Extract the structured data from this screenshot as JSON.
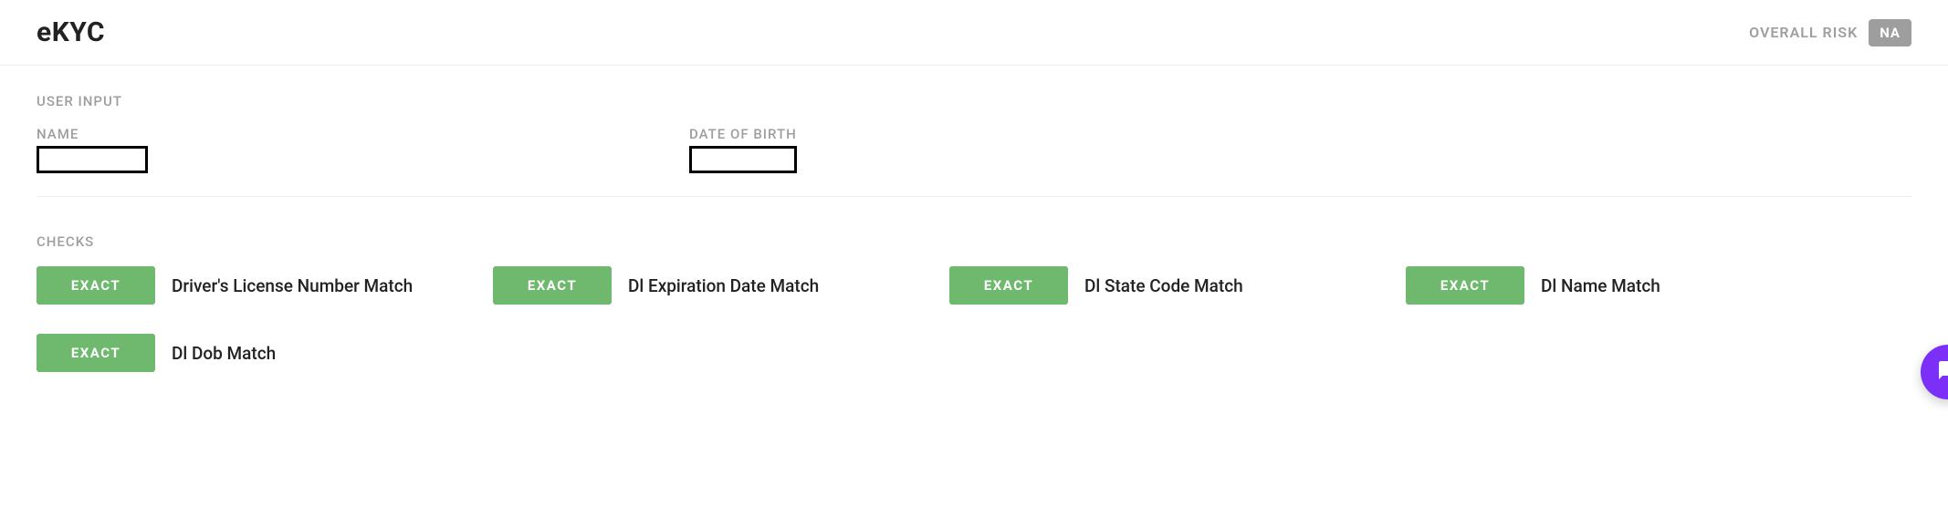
{
  "header": {
    "title": "eKYC",
    "risk_label": "OVERALL RISK",
    "risk_value": "NA"
  },
  "user_input": {
    "section_title": "USER INPUT",
    "fields": [
      {
        "label": "NAME",
        "value": ""
      },
      {
        "label": "DATE OF BIRTH",
        "value": ""
      }
    ]
  },
  "checks": {
    "section_title": "CHECKS",
    "items": [
      {
        "status": "EXACT",
        "label": "Driver's License Number Match"
      },
      {
        "status": "EXACT",
        "label": "Dl Expiration Date Match"
      },
      {
        "status": "EXACT",
        "label": "Dl State Code Match"
      },
      {
        "status": "EXACT",
        "label": "Dl Name Match"
      },
      {
        "status": "EXACT",
        "label": "Dl Dob Match"
      }
    ]
  },
  "colors": {
    "exact_badge": "#6fb96f",
    "na_badge": "#9e9e9e",
    "fab": "#7b2ff7"
  }
}
